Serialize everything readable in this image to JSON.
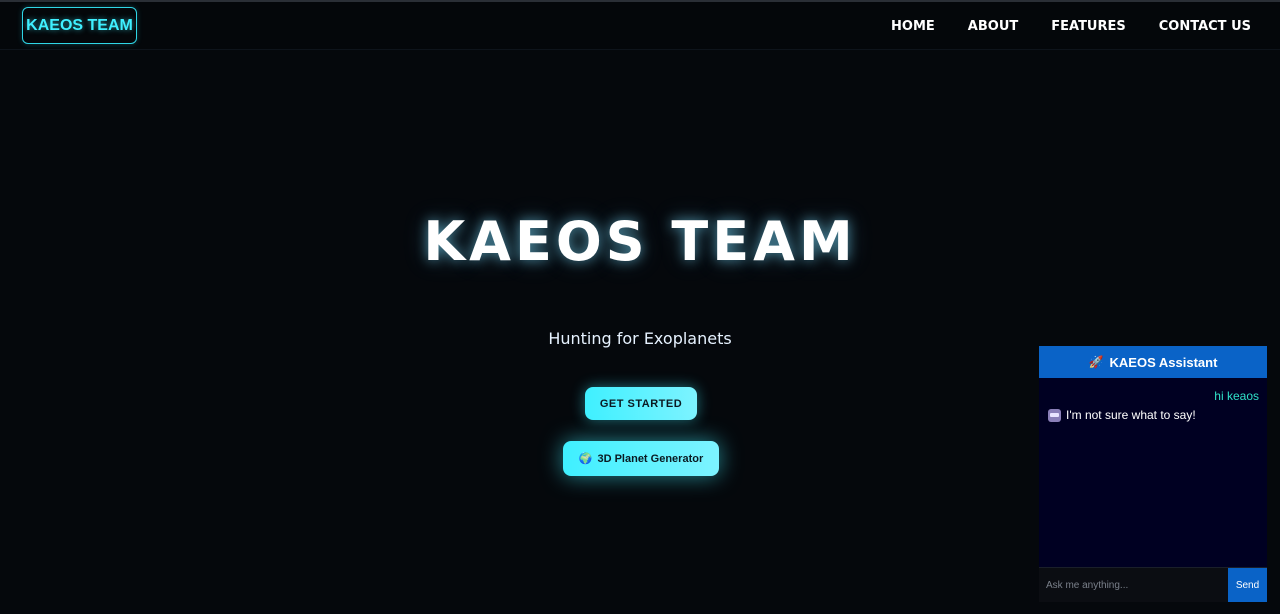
{
  "nav": {
    "logo": "KAEOS TEAM",
    "links": [
      "HOME",
      "ABOUT",
      "FEATURES",
      "CONTACT US"
    ]
  },
  "hero": {
    "title": "KAEOS TEAM",
    "subtitle": "Hunting for Exoplanets",
    "get_started_label": "GET STARTED",
    "planet_generator_label": "3D Planet Generator",
    "planet_generator_icon": "globe-icon"
  },
  "chat": {
    "header_icon": "rocket-icon",
    "title": "KAEOS Assistant",
    "messages": [
      {
        "from": "user",
        "text": "hi keaos"
      },
      {
        "from": "bot",
        "icon": "robot-icon",
        "text": "I'm not sure what to say!"
      }
    ],
    "input_placeholder": "Ask me anything...",
    "send_label": "Send"
  },
  "colors": {
    "background": "#05080c",
    "accent_cyan": "#3ff0ff",
    "chat_blue": "#0a63c7",
    "chat_background": "#000022",
    "user_message": "#2fe0c8"
  }
}
